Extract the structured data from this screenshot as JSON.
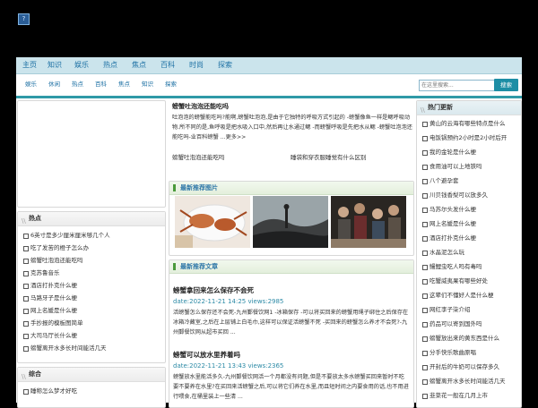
{
  "logo_glyph": "?",
  "nav_primary": [
    "主页",
    "知识",
    "娱乐",
    "热点",
    "焦点",
    "百科",
    "时尚",
    "探索"
  ],
  "nav_secondary": [
    "娱乐",
    "休闲",
    "热点",
    "百科",
    "焦点",
    "知识",
    "探索"
  ],
  "search": {
    "placeholder": "在这里搜索...",
    "button": "搜索"
  },
  "feature": {
    "title": "螃蟹吐泡泡还能吃吗",
    "body": "吐泡泡的螃蟹能吃吗?能啊,螃蟹吐泡泡,是由于它独特的呼吸方式引起的 -螃蟹像鱼一样是鳃呼吸动物.所不同的是,鱼呼吸是把水吸入口中,然后再让水通过鳃 -而螃蟹呼吸是先把水从鳃 -螃蟹吐泡泡还能吃吗-业百科螃蟹 ...更多>>",
    "links": [
      "螃蟹吐泡泡还能吃吗",
      "睡袋和穿衣服睡觉有什么区别"
    ]
  },
  "images_section": {
    "title": "最新推荐图片"
  },
  "articles_section": {
    "title": "最新推荐文章",
    "articles": [
      {
        "title": "螃蟹拿回来怎么保存不会死",
        "meta": "date:2022-11-21 14:25   views:2985",
        "body": "活螃蟹怎么保存还不会死-九州鄞餐饮网1 -冰箱保存 -可以将买回来的螃蟹用绳子绑住之后保存在冰箱冷藏室,之后在上层铺上白毛巾,这样可以保证活螃蟹不死 -买回来的螃蟹怎么养才不会死?-九州鄞餐饮网从超市买回 ..."
      },
      {
        "title": "螃蟹可以放水里养着吗",
        "meta": "date:2022-11-21 13:43   views:2365",
        "body": "螃蟹放水里能活多久-九州鄞餐饮网活一个月都没有问题,但是不要放太多水螃蟹买回来暂时不吃要不要养在水里?在买回来活螃蟹之后,可以将它们养在水里,而且短时间之内要食用的话,也不用进行喂食,在桶里装上一些清 ..."
      }
    ]
  },
  "hot_left": {
    "title": "热点",
    "items": [
      "6英寸是多少厘米厘米够几个人",
      "吃了发苦的橙子怎么办",
      "螃蟹吐泡泡还能吃吗",
      "克苏鲁音乐",
      "酒店打扑克什么梗",
      "马路牙子是什么梗",
      "网上名媛是什么梗",
      "手抄报的模板图简单",
      "大司马厅长什么梗",
      "螃蟹离开水多长时间能活几天"
    ]
  },
  "general_left": {
    "title": "综合",
    "items": [
      "睡称怎么梦才好吃"
    ]
  },
  "hot_right": {
    "title": "热门更新",
    "items": [
      "黄山的云海有哪些特点是什么",
      "电饭锅预约2小时是2小时后开",
      "我的金轮是什么梗",
      "食用油可以上地铁吗",
      "八个避孕套",
      "川贝钱香梨可以放多久",
      "马苏尔头发什么梗",
      "网上名媛是什么梗",
      "酒店打扑克什么梗",
      "水晶泥怎么玩",
      "鳗鲤虫吃人吗有毒吗",
      "吃蟹威夷果有哪些好处",
      "这辈们不懂好人是什么梗",
      "网红李子柒介绍",
      "药品可以寄到国外吗",
      "螃蟹放出来的黄东西是什么",
      "分手快乐歌曲原唱",
      "开封后的牛奶可以保存多久",
      "螃蟹离开水多长时间能活几天",
      "韭菜花一般在几月上市"
    ]
  }
}
